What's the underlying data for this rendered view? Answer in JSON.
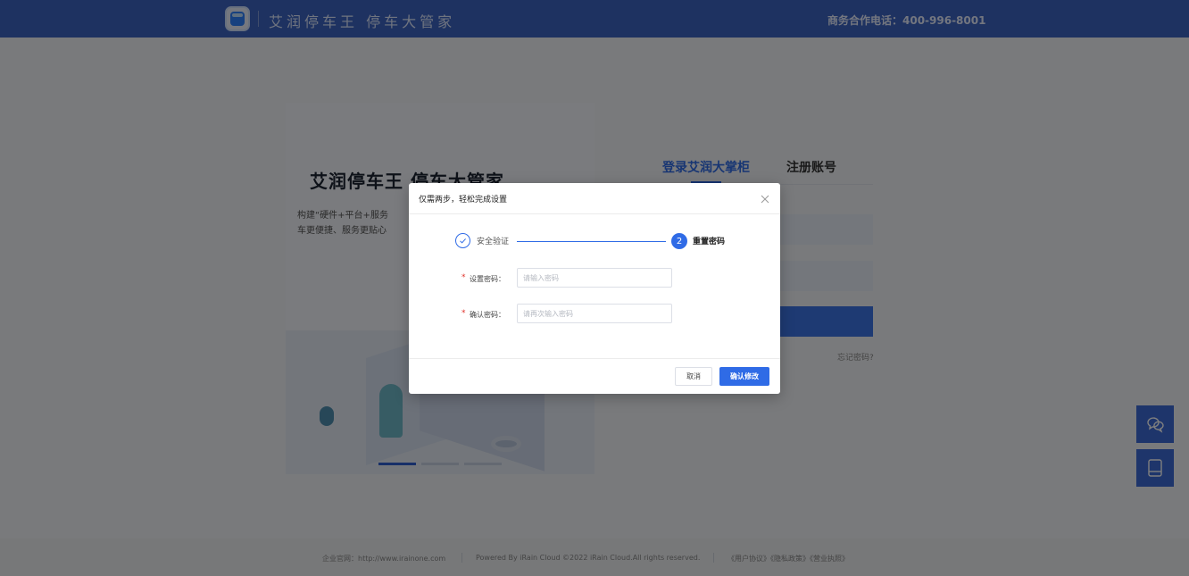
{
  "header": {
    "brand": "艾润停车王 停车大管家",
    "hotline": "商务合作电话：400-996-8001",
    "logo_icon": "parking-app-logo"
  },
  "hero": {
    "title": "艾润停车王 停车大管家",
    "desc_line1": "构建“硬件+平台+服务",
    "desc_line2": "车更便捷、服务更贴心"
  },
  "login": {
    "tab_login": "登录艾润大掌柜",
    "tab_register": "注册账号",
    "forgot": "忘记密码?"
  },
  "modal": {
    "title": "仅需两步，轻松完成设置",
    "steps": [
      {
        "label": "安全验证",
        "state": "done"
      },
      {
        "number": "2",
        "label": "重置密码",
        "state": "active"
      }
    ],
    "fields": {
      "new_password_label": "设置密码：",
      "new_password_placeholder": "请输入密码",
      "new_password_value": "",
      "confirm_password_label": "确认密码：",
      "confirm_password_placeholder": "请再次输入密码",
      "confirm_password_value": ""
    },
    "cancel_label": "取消",
    "confirm_label": "确认修改"
  },
  "side_buttons": {
    "icons": [
      "chat-icon",
      "tablet-icon"
    ]
  },
  "footer": {
    "site": "企业官网：http://www.irainone.com",
    "powered": "Powered By iRain Cloud ©2022 iRain Cloud.All rights reserved.",
    "links": "《用户协议》《隐私政策》《营业执照》"
  },
  "colors": {
    "header_bg": "#3d64c2",
    "accent": "#2f6be6",
    "required": "#e0322b"
  }
}
